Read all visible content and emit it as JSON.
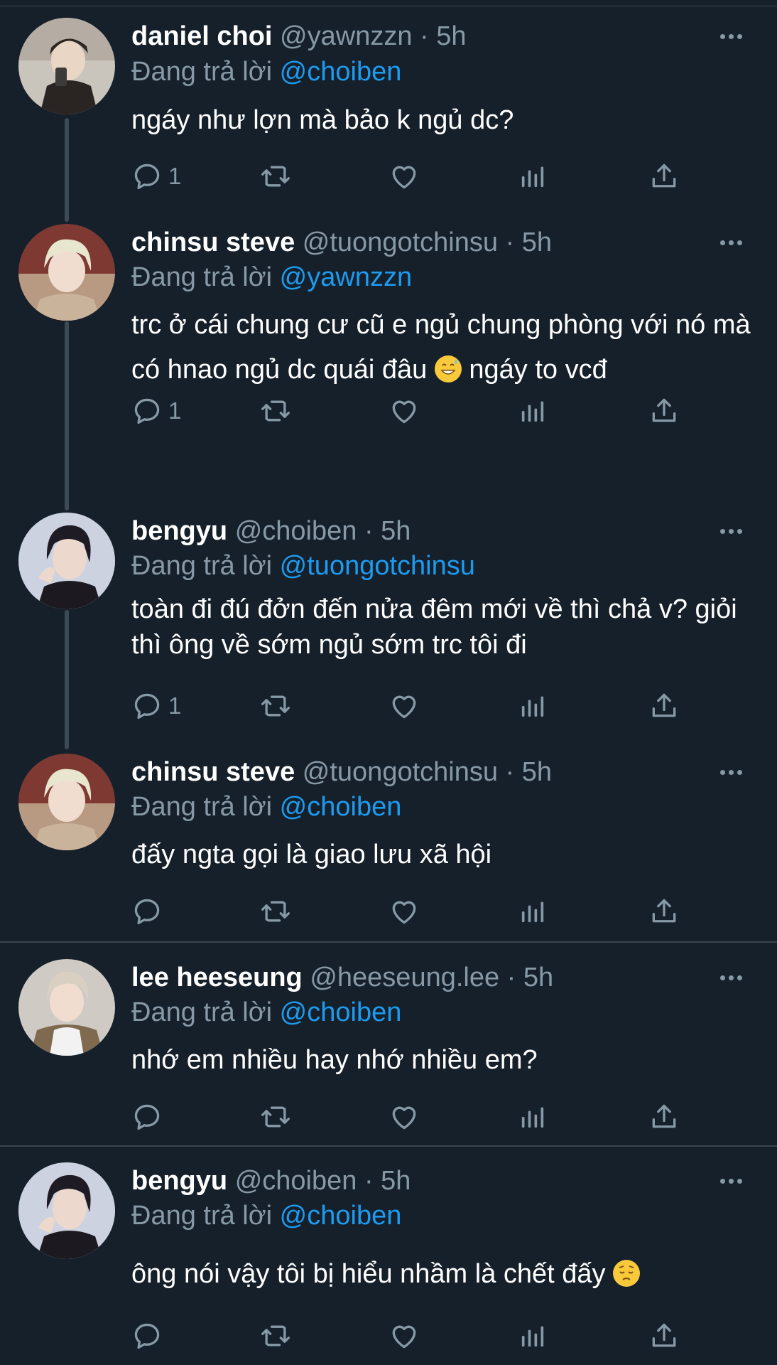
{
  "reply_prefix": "Đang trả lời",
  "tweets": [
    {
      "name": "daniel choi",
      "handle": "@yawnzzn",
      "time": "· 5h",
      "reply_to": "@choiben",
      "text": "ngáy như lợn mà bảo k ngủ dc?",
      "reply_count": "1",
      "avatar_icon": "avatar-daniel-choi"
    },
    {
      "name": "chinsu steve",
      "handle": "@tuongotchinsu",
      "time": "· 5h",
      "reply_to": "@yawnzzn",
      "text_before_emoji": "trc ở cái chung cư cũ e ngủ chung phòng với nó mà có hnao ngủ dc quái đâu ",
      "text_after_emoji": " ngáy to vcđ",
      "emoji": "grinning-sweat-emoji",
      "reply_count": "1",
      "avatar_icon": "avatar-chinsu-steve"
    },
    {
      "name": "bengyu",
      "handle": "@choiben",
      "time": "· 5h",
      "reply_to": "@tuongotchinsu",
      "text": "toàn đi đú đởn đến nửa đêm mới về thì chả v? giỏi thì ông về sớm ngủ sớm trc tôi đi",
      "reply_count": "1",
      "avatar_icon": "avatar-bengyu"
    },
    {
      "name": "chinsu steve",
      "handle": "@tuongotchinsu",
      "time": "· 5h",
      "reply_to": "@choiben",
      "text": "đấy ngta gọi là giao lưu xã hội",
      "reply_count": "",
      "avatar_icon": "avatar-chinsu-steve"
    },
    {
      "name": "lee heeseung",
      "handle": "@heeseung.lee",
      "time": "· 5h",
      "reply_to": "@choiben",
      "text": "nhớ em nhiều hay nhớ nhiều em?",
      "reply_count": "",
      "avatar_icon": "avatar-lee-heeseung"
    },
    {
      "name": "bengyu",
      "handle": "@choiben",
      "time": "· 5h",
      "reply_to": "@choiben",
      "text_before_emoji": "ông nói vậy tôi bị hiểu nhầm là chết đấy ",
      "text_after_emoji": "",
      "emoji": "pensive-face-emoji",
      "reply_count": "",
      "avatar_icon": "avatar-bengyu"
    }
  ],
  "icons": [
    "reply-icon",
    "retweet-icon",
    "like-icon",
    "views-icon",
    "share-icon",
    "more-icon"
  ],
  "colors": {
    "background": "#15202b",
    "text": "#ffffff",
    "secondary": "#8899a6",
    "mention": "#1d9bf0",
    "divider": "#38444d"
  }
}
